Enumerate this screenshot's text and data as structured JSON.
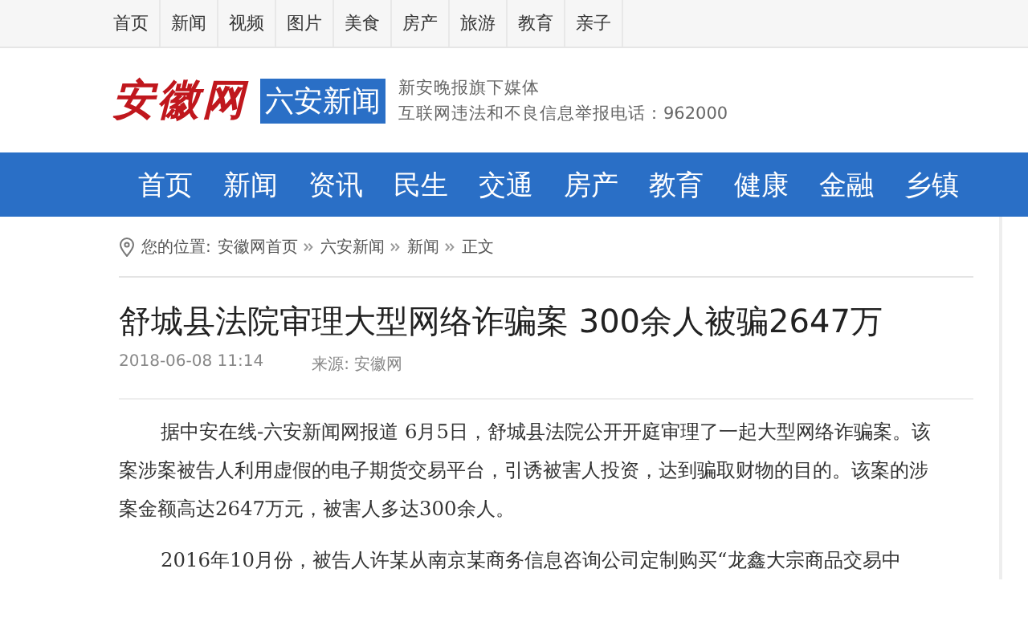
{
  "top_nav": [
    "首页",
    "新闻",
    "视频",
    "图片",
    "美食",
    "房产",
    "旅游",
    "教育",
    "亲子"
  ],
  "header": {
    "logo": "安徽网",
    "channel": "六安新闻",
    "tagline": "新安晚报旗下媒体",
    "hotline": "互联网违法和不良信息举报电话：962000"
  },
  "main_nav": [
    "首页",
    "新闻",
    "资讯",
    "民生",
    "交通",
    "房产",
    "教育",
    "健康",
    "金融",
    "乡镇"
  ],
  "breadcrumb": {
    "label": "您的位置:",
    "items": [
      "安徽网首页",
      "六安新闻",
      "新闻",
      "正文"
    ]
  },
  "article": {
    "title": "舒城县法院审理大型网络诈骗案 300余人被骗2647万",
    "date": "2018-06-08 11:14",
    "source": "来源: 安徽网",
    "paragraphs": [
      "据中安在线-六安新闻网报道  6月5日，舒城县法院公开开庭审理了一起大型网络诈骗案。该案涉案被告人利用虚假的电子期货交易平台，引诱被害人投资，达到骗取财物的目的。该案的涉案金额高达2647万元，被害人多达300余人。",
      "2016年10月份，被告人许某从南京某商务信息咨询公司定制购买“龙鑫大宗商品交易中"
    ]
  }
}
